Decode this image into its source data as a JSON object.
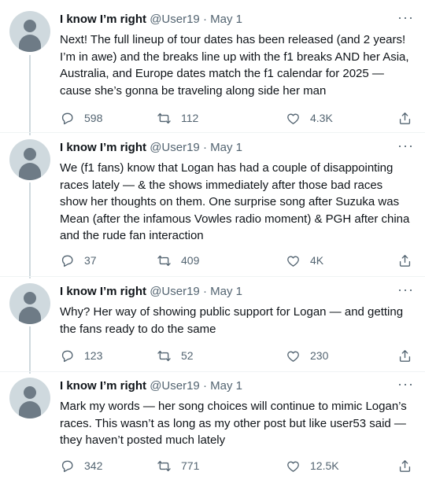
{
  "tweets": [
    {
      "name": "I know I’m right",
      "handle": "@User19",
      "sep": "·",
      "date": "May 1",
      "text": "Next! The full lineup of tour dates has been released (and 2 years! I’m in awe) and the breaks line up with the f1 breaks AND her Asia, Australia, and Europe dates match the f1 calendar for 2025 — cause she’s gonna be traveling along side her man",
      "replies": "598",
      "retweets": "112",
      "likes": "4.3K"
    },
    {
      "name": "I know I’m right",
      "handle": "@User19",
      "sep": "·",
      "date": "May 1",
      "text": "We (f1 fans) know that Logan has had a couple of disappointing races lately — & the shows immediately after those bad races show her thoughts on them. One surprise song after Suzuka was Mean (after the infamous Vowles radio moment) & PGH after china and the rude fan interaction",
      "replies": "37",
      "retweets": "409",
      "likes": "4K"
    },
    {
      "name": "I know I’m right",
      "handle": "@User19",
      "sep": "·",
      "date": "May 1",
      "text": "Why? Her way of showing public support for Logan — and getting the fans ready to do the same",
      "replies": "123",
      "retweets": "52",
      "likes": "230"
    },
    {
      "name": "I know I’m right",
      "handle": "@User19",
      "sep": "·",
      "date": "May 1",
      "text": "Mark my words — her song choices will continue to mimic Logan’s races. This wasn’t as long as my other post but like user53 said — they haven’t posted much lately",
      "replies": "342",
      "retweets": "771",
      "likes": "12.5K"
    }
  ],
  "icons": {
    "reply": "reply-icon",
    "retweet": "retweet-icon",
    "like": "heart-icon",
    "share": "share-icon",
    "more": "more-icon"
  },
  "colors": {
    "text": "#0f1419",
    "secondary": "#536471",
    "thread_line": "#cfd9de",
    "avatar_bg": "#cfd9de",
    "avatar_fg": "#6e7b86"
  }
}
